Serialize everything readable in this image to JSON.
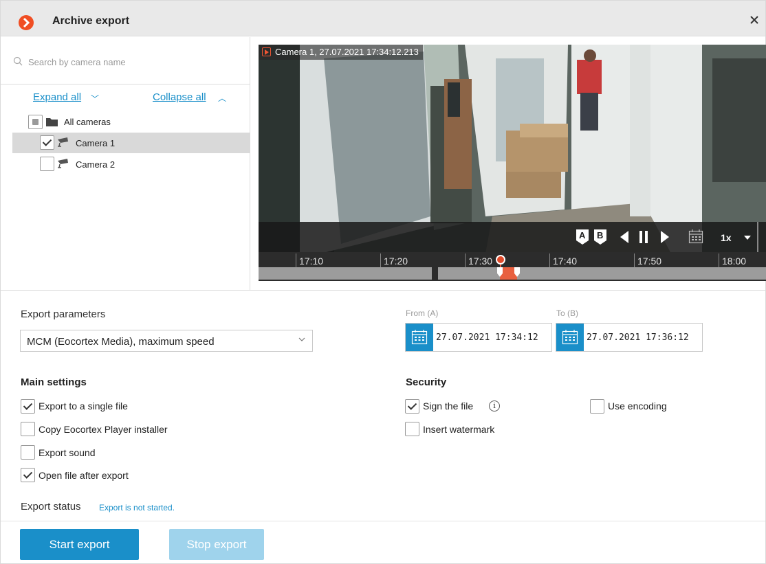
{
  "window": {
    "title": "Archive export"
  },
  "left_panel": {
    "search_placeholder": "Search by camera name",
    "expand_all": "Expand all",
    "collapse_all": "Collapse all",
    "tree": [
      {
        "label": "All cameras",
        "state": "partial",
        "icon": "folder-icon"
      },
      {
        "label": "Camera 1",
        "state": "checked",
        "icon": "camera-icon",
        "selected": true
      },
      {
        "label": "Camera 2",
        "state": "unchecked",
        "icon": "camera-icon"
      }
    ]
  },
  "player": {
    "caption": "Camera 1, 27.07.2021 17:34:12.213",
    "controls": {
      "mark_a": "A",
      "mark_b": "B",
      "speed": "1x"
    },
    "timeline_ticks": [
      "17:10",
      "17:20",
      "17:30",
      "17:40",
      "17:50",
      "18:00"
    ]
  },
  "export": {
    "params_label": "Export parameters",
    "format": "MCM (Eocortex Media), maximum speed",
    "from_label": "From (A)",
    "to_label": "To (B)",
    "from_value": "27.07.2021  17:34:12",
    "to_value": "27.07.2021  17:36:12"
  },
  "main_settings": {
    "heading": "Main settings",
    "options": [
      {
        "label": "Export to a single file",
        "checked": true
      },
      {
        "label": "Copy Eocortex Player installer",
        "checked": false
      },
      {
        "label": "Export sound",
        "checked": false
      },
      {
        "label": "Open file after export",
        "checked": true
      }
    ]
  },
  "security": {
    "heading": "Security",
    "sign_file": {
      "label": "Sign the file",
      "checked": true
    },
    "info_icon": "i",
    "use_encoding": {
      "label": "Use encoding",
      "checked": false
    },
    "insert_watermark": {
      "label": "Insert watermark",
      "checked": false
    }
  },
  "status": {
    "label": "Export status",
    "value": "Export is not started."
  },
  "buttons": {
    "start": "Start export",
    "stop": "Stop export"
  },
  "colors": {
    "accent": "#1a8fc9",
    "accent_disabled": "#9fd3ec",
    "logo": "#f04e23",
    "timeline_selection": "#e86040"
  }
}
